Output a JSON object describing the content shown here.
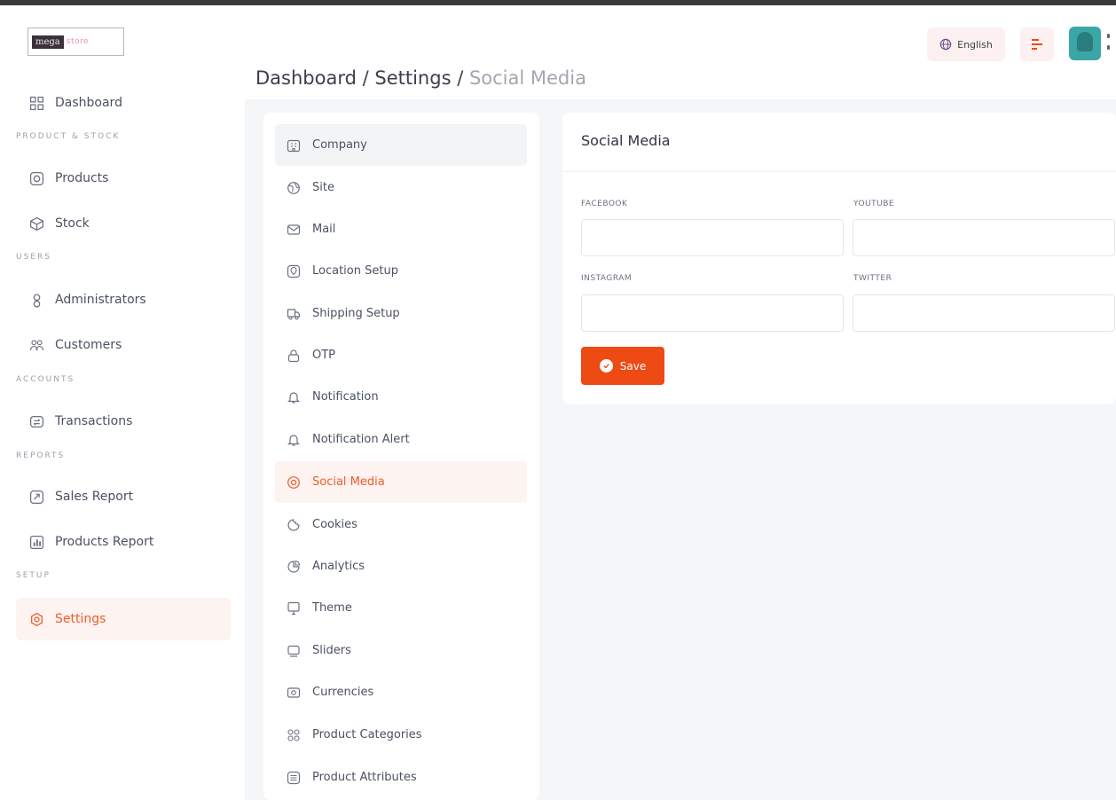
{
  "header": {
    "logo_primary": "mega",
    "logo_secondary": "store",
    "language_label": "English"
  },
  "sidebar": {
    "items": [
      {
        "label": "Dashboard",
        "icon": "grid-icon"
      },
      {
        "label": "Products",
        "icon": "products-icon"
      },
      {
        "label": "Stock",
        "icon": "box-icon"
      },
      {
        "label": "Administrators",
        "icon": "user-icon"
      },
      {
        "label": "Customers",
        "icon": "users-icon"
      },
      {
        "label": "Transactions",
        "icon": "transactions-icon"
      },
      {
        "label": "Sales Report",
        "icon": "report-icon"
      },
      {
        "label": "Products Report",
        "icon": "chart-icon"
      },
      {
        "label": "Settings",
        "icon": "gear-icon"
      }
    ],
    "sections": {
      "product_stock": "PRODUCT & STOCK",
      "users": "USERS",
      "accounts": "ACCOUNTS",
      "reports": "REPORTS",
      "setup": "SETUP"
    }
  },
  "breadcrumb": {
    "part1": "Dashboard",
    "sep1": " / ",
    "part2": "Settings",
    "sep2": " / ",
    "current": "Social Media"
  },
  "settings_menu": {
    "items": [
      {
        "label": "Company",
        "icon": "building-icon"
      },
      {
        "label": "Site",
        "icon": "globe-icon"
      },
      {
        "label": "Mail",
        "icon": "mail-icon"
      },
      {
        "label": "Location Setup",
        "icon": "location-icon"
      },
      {
        "label": "Shipping Setup",
        "icon": "truck-icon"
      },
      {
        "label": "OTP",
        "icon": "lock-icon"
      },
      {
        "label": "Notification",
        "icon": "bell-icon"
      },
      {
        "label": "Notification Alert",
        "icon": "bell-alert-icon"
      },
      {
        "label": "Social Media",
        "icon": "social-icon"
      },
      {
        "label": "Cookies",
        "icon": "cookie-icon"
      },
      {
        "label": "Analytics",
        "icon": "analytics-icon"
      },
      {
        "label": "Theme",
        "icon": "theme-icon"
      },
      {
        "label": "Sliders",
        "icon": "slider-icon"
      },
      {
        "label": "Currencies",
        "icon": "currency-icon"
      },
      {
        "label": "Product Categories",
        "icon": "categories-icon"
      },
      {
        "label": "Product Attributes",
        "icon": "attributes-icon"
      }
    ],
    "active": "Social Media"
  },
  "social_form": {
    "title": "Social Media",
    "facebook_label": "FACEBOOK",
    "facebook_value": "",
    "youtube_label": "YOUTUBE",
    "youtube_value": "",
    "instagram_label": "INSTAGRAM",
    "instagram_value": "",
    "twitter_label": "TWITTER",
    "twitter_value": "",
    "save_label": "Save"
  },
  "colors": {
    "accent": "#ee4a14",
    "active_bg": "#fdf3f0",
    "content_bg": "#f5f6f8"
  }
}
